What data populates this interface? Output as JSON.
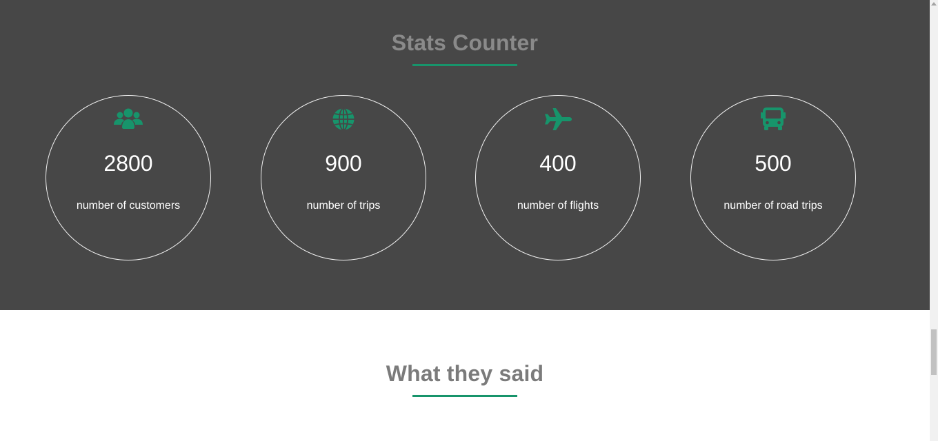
{
  "stats_section": {
    "title": "Stats Counter",
    "background_color": "#474747",
    "accent_color": "#17946b",
    "items": [
      {
        "icon": "users-icon",
        "number": "2800",
        "label": "number of customers"
      },
      {
        "icon": "globe-icon",
        "number": "900",
        "label": "number of trips"
      },
      {
        "icon": "plane-icon",
        "number": "400",
        "label": "number of flights"
      },
      {
        "icon": "bus-icon",
        "number": "500",
        "label": "number of road trips"
      }
    ]
  },
  "testimonials_section": {
    "title": "What they said"
  }
}
